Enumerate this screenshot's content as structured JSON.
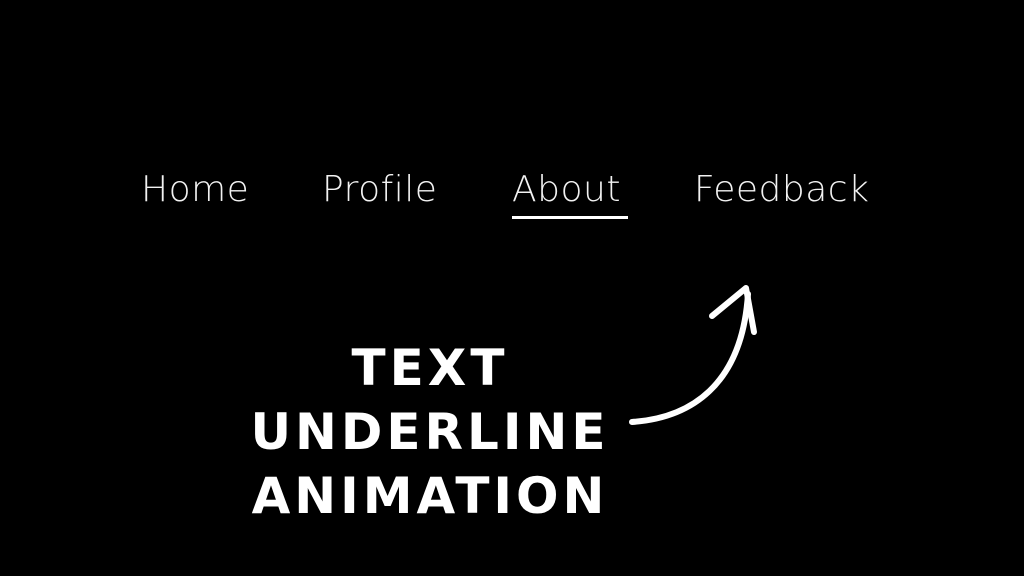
{
  "nav": {
    "items": [
      {
        "label": "Home"
      },
      {
        "label": "Profile"
      },
      {
        "label": "About"
      },
      {
        "label": "Feedback"
      }
    ],
    "active_index": 2
  },
  "caption": {
    "line1": "Text Underline",
    "line2": "Animation"
  },
  "colors": {
    "background": "#000000",
    "text": "#f2f2f2",
    "accent": "#ffffff"
  },
  "icons": {
    "arrow": "curved-arrow-icon"
  }
}
